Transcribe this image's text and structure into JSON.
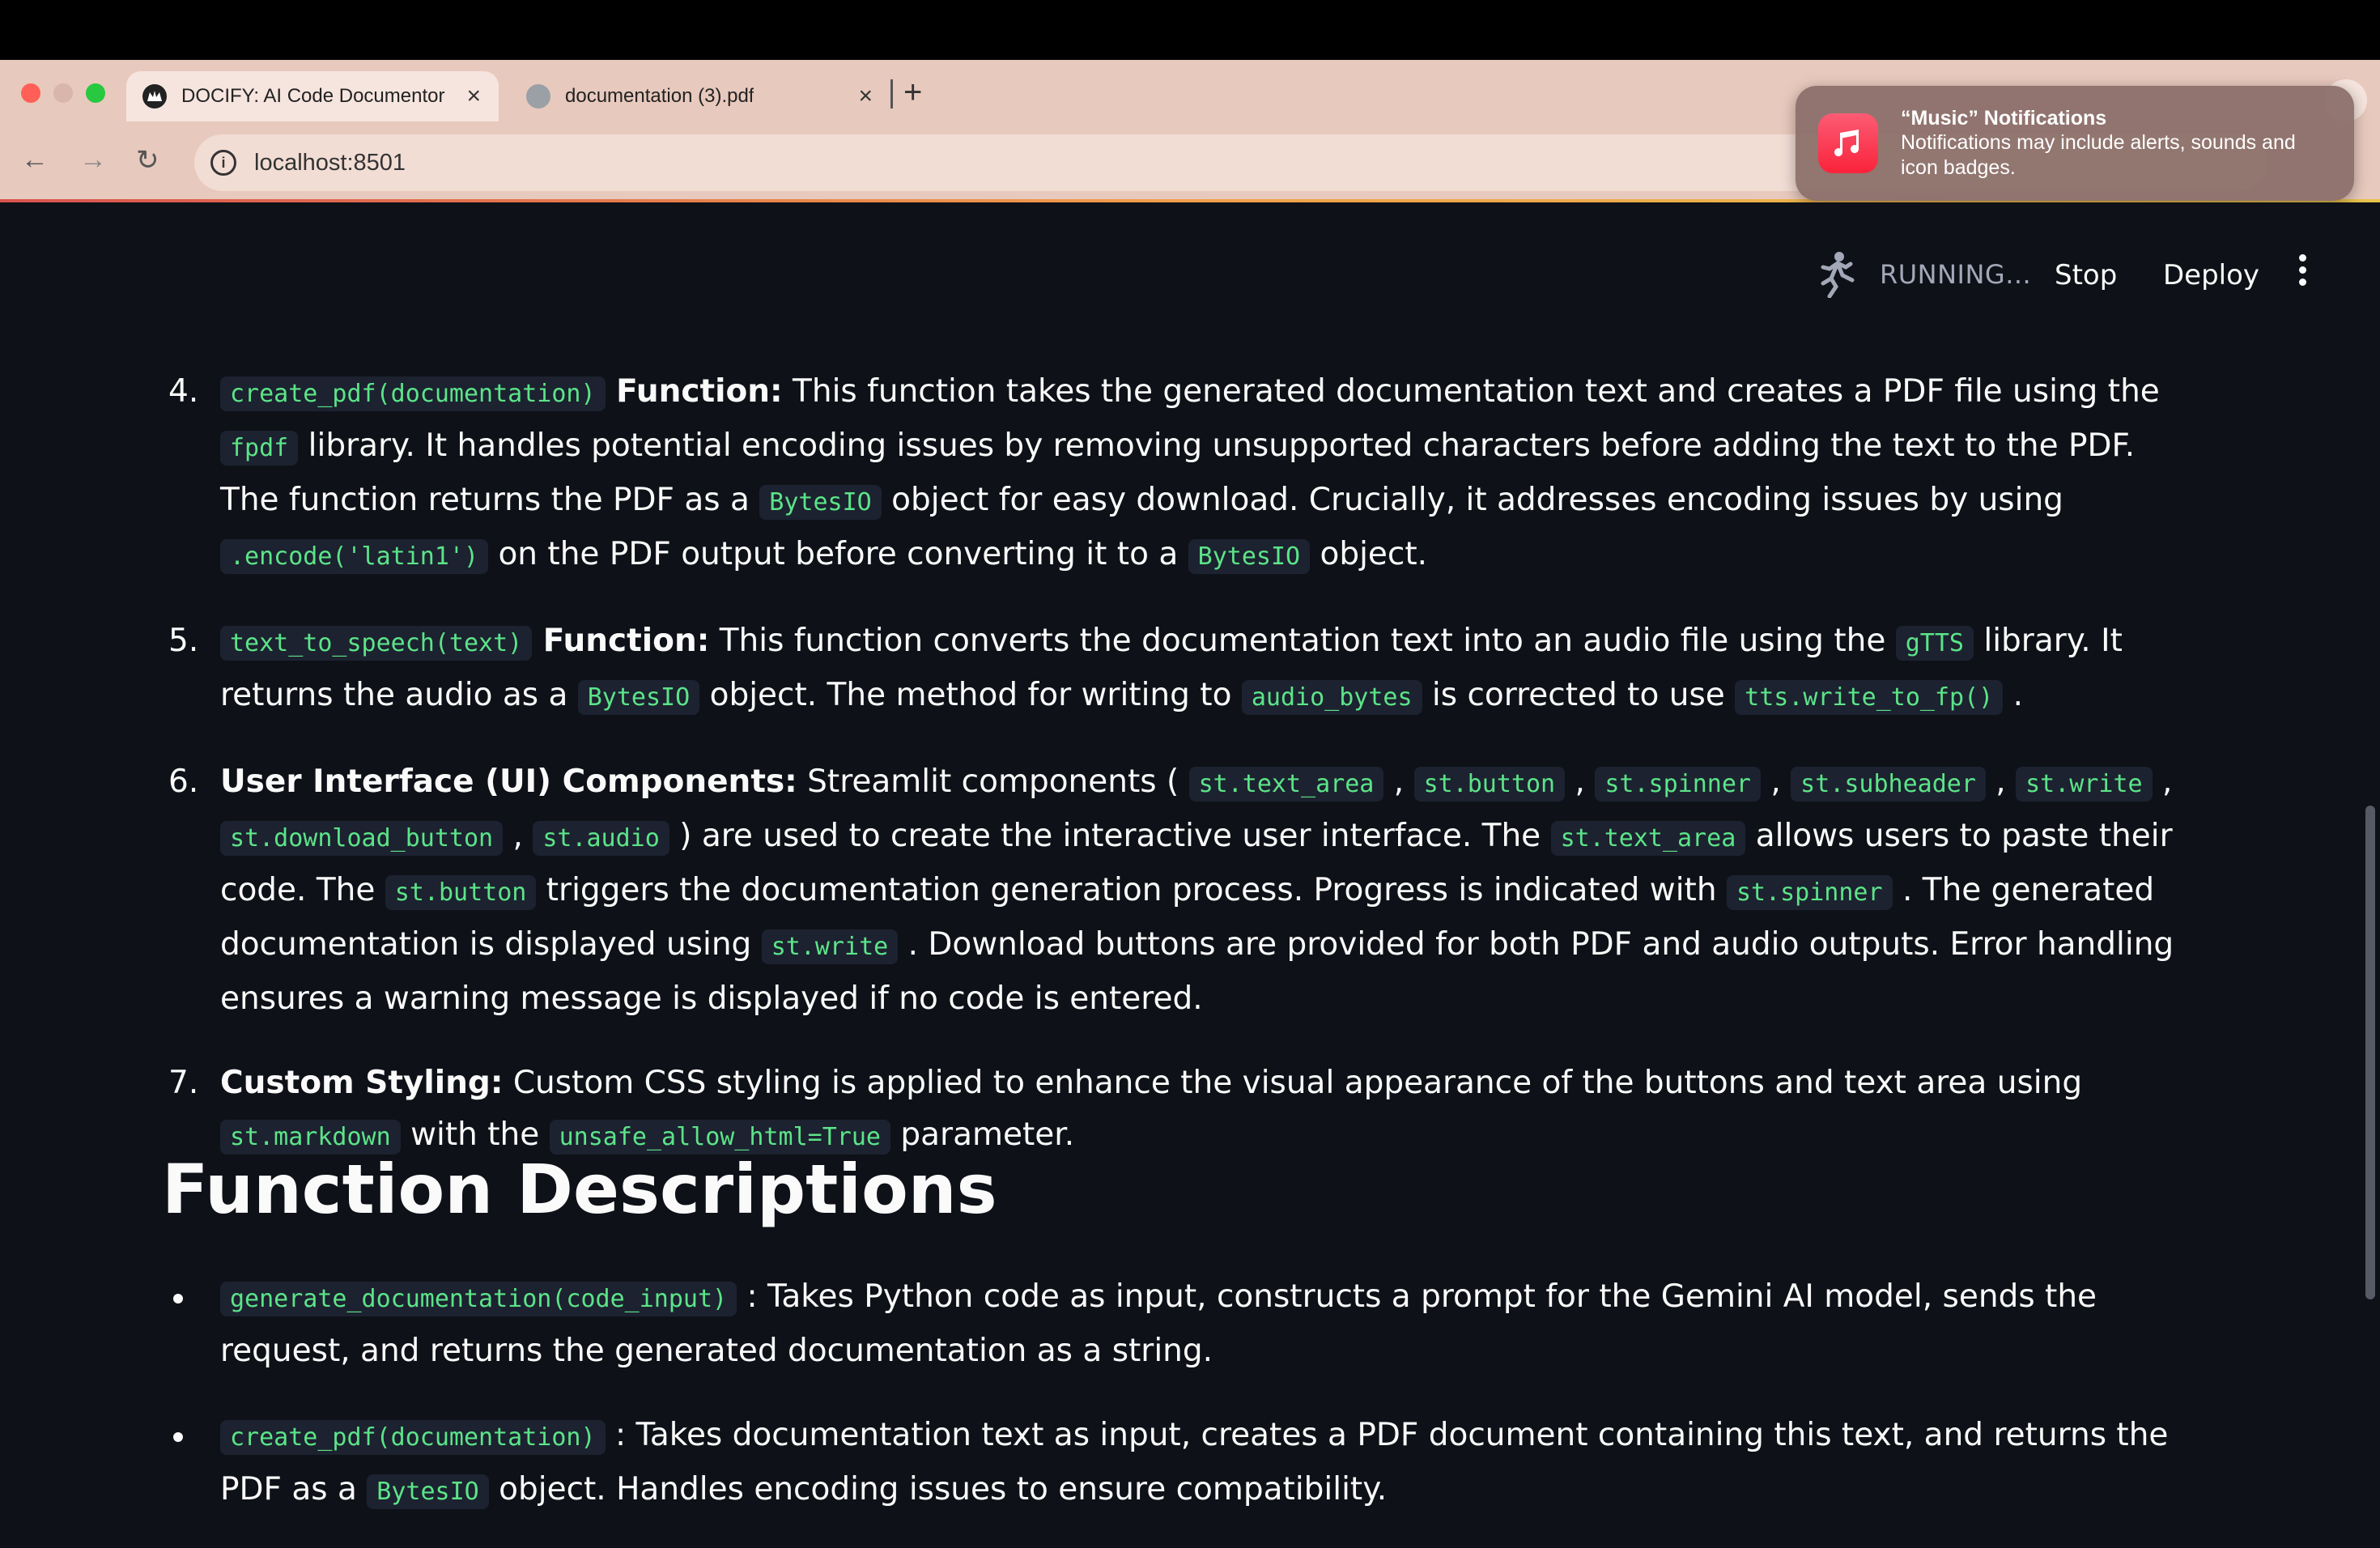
{
  "browser": {
    "tabs": [
      {
        "title": "DOCIFY: AI Code Documentor",
        "active": true
      },
      {
        "title": "documentation (3).pdf",
        "active": false
      }
    ],
    "address": "localhost:8501"
  },
  "notification": {
    "title": "“Music” Notifications",
    "body": "Notifications may include alerts, sounds and icon badges."
  },
  "header": {
    "status": "RUNNING...",
    "stop_label": "Stop",
    "deploy_label": "Deploy"
  },
  "list_items": [
    {
      "num": "4.",
      "segments": [
        {
          "t": "code",
          "v": "create_pdf(documentation)"
        },
        {
          "t": "bold",
          "v": " Function:"
        },
        {
          "t": "text",
          "v": " This function takes the generated documentation text and creates a PDF file using the "
        },
        {
          "t": "code",
          "v": "fpdf"
        },
        {
          "t": "text",
          "v": " library. It handles potential encoding issues by removing unsupported characters before adding the text to the PDF. The function returns the PDF as a "
        },
        {
          "t": "code",
          "v": "BytesIO"
        },
        {
          "t": "text",
          "v": " object for easy download. Crucially, it addresses encoding issues by using "
        },
        {
          "t": "code",
          "v": ".encode('latin1')"
        },
        {
          "t": "text",
          "v": " on the PDF output before converting it to a "
        },
        {
          "t": "code",
          "v": "BytesIO"
        },
        {
          "t": "text",
          "v": " object."
        }
      ]
    },
    {
      "num": "5.",
      "segments": [
        {
          "t": "code",
          "v": "text_to_speech(text)"
        },
        {
          "t": "bold",
          "v": " Function:"
        },
        {
          "t": "text",
          "v": " This function converts the documentation text into an audio file using the "
        },
        {
          "t": "code",
          "v": "gTTS"
        },
        {
          "t": "text",
          "v": " library. It returns the audio as a "
        },
        {
          "t": "code",
          "v": "BytesIO"
        },
        {
          "t": "text",
          "v": " object. The method for writing to "
        },
        {
          "t": "code",
          "v": "audio_bytes"
        },
        {
          "t": "text",
          "v": " is corrected to use "
        },
        {
          "t": "code",
          "v": "tts.write_to_fp()"
        },
        {
          "t": "text",
          "v": " ."
        }
      ]
    },
    {
      "num": "6.",
      "segments": [
        {
          "t": "bold",
          "v": "User Interface (UI) Components:"
        },
        {
          "t": "text",
          "v": " Streamlit components ( "
        },
        {
          "t": "code",
          "v": "st.text_area"
        },
        {
          "t": "text",
          "v": " , "
        },
        {
          "t": "code",
          "v": "st.button"
        },
        {
          "t": "text",
          "v": " , "
        },
        {
          "t": "code",
          "v": "st.spinner"
        },
        {
          "t": "text",
          "v": " , "
        },
        {
          "t": "code",
          "v": "st.subheader"
        },
        {
          "t": "text",
          "v": " , "
        },
        {
          "t": "code",
          "v": "st.write"
        },
        {
          "t": "text",
          "v": " , "
        },
        {
          "t": "code",
          "v": "st.download_button"
        },
        {
          "t": "text",
          "v": " , "
        },
        {
          "t": "code",
          "v": "st.audio"
        },
        {
          "t": "text",
          "v": " ) are used to create the interactive user interface. The "
        },
        {
          "t": "code",
          "v": "st.text_area"
        },
        {
          "t": "text",
          "v": " allows users to paste their code. The "
        },
        {
          "t": "code",
          "v": "st.button"
        },
        {
          "t": "text",
          "v": " triggers the documentation generation process. Progress is indicated with "
        },
        {
          "t": "code",
          "v": "st.spinner"
        },
        {
          "t": "text",
          "v": " . The generated documentation is displayed using "
        },
        {
          "t": "code",
          "v": "st.write"
        },
        {
          "t": "text",
          "v": " . Download buttons are provided for both PDF and audio outputs. Error handling ensures a warning message is displayed if no code is entered."
        }
      ]
    },
    {
      "num": "7.",
      "segments": [
        {
          "t": "bold",
          "v": "Custom Styling:"
        },
        {
          "t": "text",
          "v": " Custom CSS styling is applied to enhance the visual appearance of the buttons and text area using "
        },
        {
          "t": "code",
          "v": "st.markdown"
        },
        {
          "t": "text",
          "v": " with the "
        },
        {
          "t": "code",
          "v": "unsafe_allow_html=True"
        },
        {
          "t": "text",
          "v": " parameter."
        }
      ]
    }
  ],
  "section_heading": "Function Descriptions",
  "bullets": [
    {
      "segments": [
        {
          "t": "code",
          "v": "generate_documentation(code_input)"
        },
        {
          "t": "text",
          "v": " : Takes Python code as input, constructs a prompt for the Gemini AI model, sends the request, and returns the generated documentation as a string."
        }
      ]
    },
    {
      "segments": [
        {
          "t": "code",
          "v": "create_pdf(documentation)"
        },
        {
          "t": "text",
          "v": " : Takes documentation text as input, creates a PDF document containing this text, and returns the PDF as a "
        },
        {
          "t": "code",
          "v": "BytesIO"
        },
        {
          "t": "text",
          "v": " object. Handles encoding issues to ensure compatibility."
        }
      ]
    }
  ],
  "colors": {
    "background": "#0e1117",
    "code_text": "#5ce488",
    "code_bg": "#1c2230",
    "browser_chrome": "#e8c9bd"
  }
}
